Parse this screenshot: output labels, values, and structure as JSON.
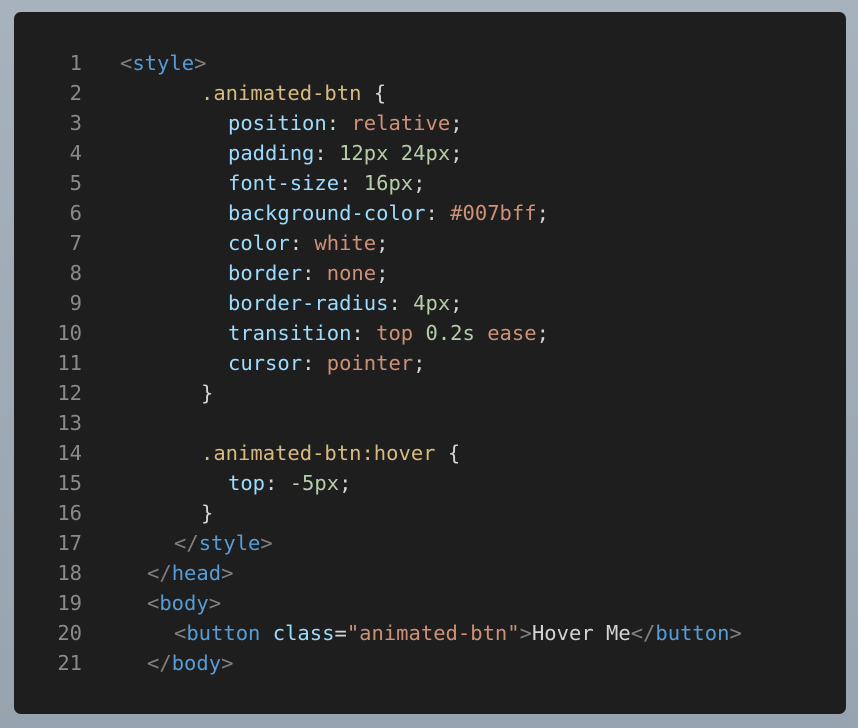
{
  "colors": {
    "background": "#9ea9b4",
    "editor_background": "#1e1e1e",
    "line_number": "#8a8a8a",
    "tag": "#569cd6",
    "punctuation": "#808080",
    "selector": "#d7ba7d",
    "property": "#9cdcfe",
    "keyword_value": "#ce9178",
    "number": "#b5cea8",
    "string": "#ce9178",
    "plain": "#d4d4d4"
  },
  "lines": [
    {
      "number": "1",
      "indent": 0,
      "tokens": [
        {
          "t": "<",
          "k": "punc"
        },
        {
          "t": "style",
          "k": "tag"
        },
        {
          "t": ">",
          "k": "punc"
        }
      ]
    },
    {
      "number": "2",
      "indent": 6,
      "tokens": [
        {
          "t": ".animated-btn",
          "k": "sel"
        },
        {
          "t": " {",
          "k": "plain"
        }
      ]
    },
    {
      "number": "3",
      "indent": 8,
      "tokens": [
        {
          "t": "position",
          "k": "prop"
        },
        {
          "t": ": ",
          "k": "plain"
        },
        {
          "t": "relative",
          "k": "kw"
        },
        {
          "t": ";",
          "k": "plain"
        }
      ]
    },
    {
      "number": "4",
      "indent": 8,
      "tokens": [
        {
          "t": "padding",
          "k": "prop"
        },
        {
          "t": ": ",
          "k": "plain"
        },
        {
          "t": "12px 24px",
          "k": "num"
        },
        {
          "t": ";",
          "k": "plain"
        }
      ]
    },
    {
      "number": "5",
      "indent": 8,
      "tokens": [
        {
          "t": "font-size",
          "k": "prop"
        },
        {
          "t": ": ",
          "k": "plain"
        },
        {
          "t": "16px",
          "k": "num"
        },
        {
          "t": ";",
          "k": "plain"
        }
      ]
    },
    {
      "number": "6",
      "indent": 8,
      "tokens": [
        {
          "t": "background-color",
          "k": "prop"
        },
        {
          "t": ": ",
          "k": "plain"
        },
        {
          "t": "#007bff",
          "k": "kw"
        },
        {
          "t": ";",
          "k": "plain"
        }
      ]
    },
    {
      "number": "7",
      "indent": 8,
      "tokens": [
        {
          "t": "color",
          "k": "prop"
        },
        {
          "t": ": ",
          "k": "plain"
        },
        {
          "t": "white",
          "k": "kw"
        },
        {
          "t": ";",
          "k": "plain"
        }
      ]
    },
    {
      "number": "8",
      "indent": 8,
      "tokens": [
        {
          "t": "border",
          "k": "prop"
        },
        {
          "t": ": ",
          "k": "plain"
        },
        {
          "t": "none",
          "k": "kw"
        },
        {
          "t": ";",
          "k": "plain"
        }
      ]
    },
    {
      "number": "9",
      "indent": 8,
      "tokens": [
        {
          "t": "border-radius",
          "k": "prop"
        },
        {
          "t": ": ",
          "k": "plain"
        },
        {
          "t": "4px",
          "k": "num"
        },
        {
          "t": ";",
          "k": "plain"
        }
      ]
    },
    {
      "number": "10",
      "indent": 8,
      "tokens": [
        {
          "t": "transition",
          "k": "prop"
        },
        {
          "t": ": ",
          "k": "plain"
        },
        {
          "t": "top",
          "k": "kw"
        },
        {
          "t": " ",
          "k": "plain"
        },
        {
          "t": "0.2s",
          "k": "num"
        },
        {
          "t": " ",
          "k": "plain"
        },
        {
          "t": "ease",
          "k": "kw"
        },
        {
          "t": ";",
          "k": "plain"
        }
      ]
    },
    {
      "number": "11",
      "indent": 8,
      "tokens": [
        {
          "t": "cursor",
          "k": "prop"
        },
        {
          "t": ": ",
          "k": "plain"
        },
        {
          "t": "pointer",
          "k": "kw"
        },
        {
          "t": ";",
          "k": "plain"
        }
      ]
    },
    {
      "number": "12",
      "indent": 6,
      "tokens": [
        {
          "t": "}",
          "k": "plain"
        }
      ]
    },
    {
      "number": "13",
      "indent": 0,
      "tokens": []
    },
    {
      "number": "14",
      "indent": 6,
      "tokens": [
        {
          "t": ".animated-btn:hover",
          "k": "sel"
        },
        {
          "t": " {",
          "k": "plain"
        }
      ]
    },
    {
      "number": "15",
      "indent": 8,
      "tokens": [
        {
          "t": "top",
          "k": "prop"
        },
        {
          "t": ": ",
          "k": "plain"
        },
        {
          "t": "-5px",
          "k": "num"
        },
        {
          "t": ";",
          "k": "plain"
        }
      ]
    },
    {
      "number": "16",
      "indent": 6,
      "tokens": [
        {
          "t": "}",
          "k": "plain"
        }
      ]
    },
    {
      "number": "17",
      "indent": 4,
      "tokens": [
        {
          "t": "</",
          "k": "punc"
        },
        {
          "t": "style",
          "k": "tag"
        },
        {
          "t": ">",
          "k": "punc"
        }
      ]
    },
    {
      "number": "18",
      "indent": 2,
      "tokens": [
        {
          "t": "</",
          "k": "punc"
        },
        {
          "t": "head",
          "k": "tag"
        },
        {
          "t": ">",
          "k": "punc"
        }
      ]
    },
    {
      "number": "19",
      "indent": 2,
      "tokens": [
        {
          "t": "<",
          "k": "punc"
        },
        {
          "t": "body",
          "k": "tag"
        },
        {
          "t": ">",
          "k": "punc"
        }
      ]
    },
    {
      "number": "20",
      "indent": 4,
      "tokens": [
        {
          "t": "<",
          "k": "punc"
        },
        {
          "t": "button",
          "k": "tag"
        },
        {
          "t": " ",
          "k": "plain"
        },
        {
          "t": "class",
          "k": "attr"
        },
        {
          "t": "=",
          "k": "plain"
        },
        {
          "t": "\"animated-btn\"",
          "k": "str"
        },
        {
          "t": ">",
          "k": "punc"
        },
        {
          "t": "Hover Me",
          "k": "plain"
        },
        {
          "t": "</",
          "k": "punc"
        },
        {
          "t": "button",
          "k": "tag"
        },
        {
          "t": ">",
          "k": "punc"
        }
      ]
    },
    {
      "number": "21",
      "indent": 2,
      "tokens": [
        {
          "t": "</",
          "k": "punc"
        },
        {
          "t": "body",
          "k": "tag"
        },
        {
          "t": ">",
          "k": "punc"
        }
      ]
    }
  ]
}
